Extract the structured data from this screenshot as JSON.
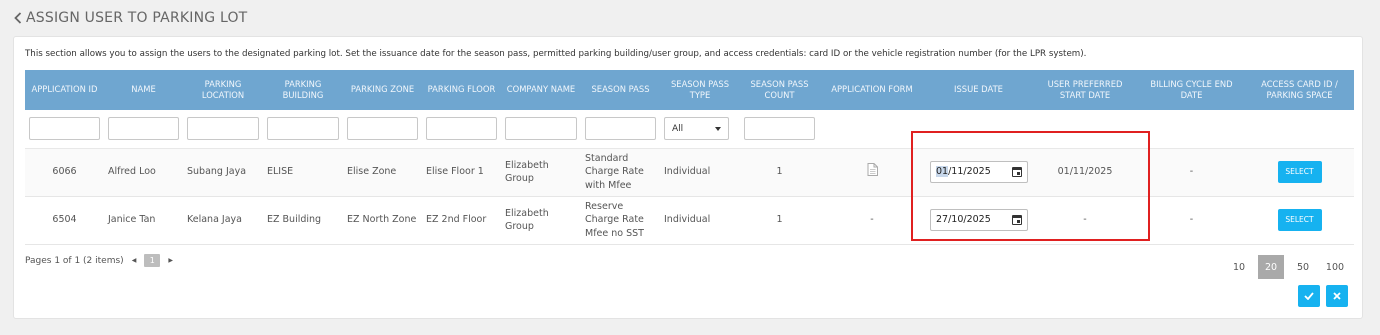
{
  "header": {
    "title": "ASSIGN USER TO PARKING LOT"
  },
  "intro_text": "This section allows you to assign the users to the designated parking lot. Set the issuance date for the season pass, permitted parking building/user group, and access credentials: card ID or the vehicle registration number (for the LPR system).",
  "columns": [
    "APPLICATION ID",
    "NAME",
    "PARKING LOCATION",
    "PARKING BUILDING",
    "PARKING ZONE",
    "PARKING FLOOR",
    "COMPANY NAME",
    "SEASON PASS",
    "SEASON PASS TYPE",
    "SEASON PASS COUNT",
    "APPLICATION FORM",
    "ISSUE DATE",
    "USER PREFERRED START DATE",
    "BILLING CYCLE END DATE",
    "ACCESS CARD ID / PARKING SPACE"
  ],
  "filter_type_value": "All",
  "rows": [
    {
      "application_id": "6066",
      "name": "Alfred Loo",
      "location": "Subang Jaya",
      "building": "ELISE",
      "zone": "Elise Zone",
      "floor": "Elise Floor 1",
      "company": "Elizabeth Group",
      "season_pass": "Standard Charge Rate with Mfee",
      "type": "Individual",
      "count": "1",
      "application_form": "document-icon",
      "issue_date_day": "01",
      "issue_date_rest": "/11/2025",
      "preferred_start": "01/11/2025",
      "billing_end": "-",
      "action_label": "SELECT"
    },
    {
      "application_id": "6504",
      "name": "Janice Tan",
      "location": "Kelana Jaya",
      "building": "EZ Building",
      "zone": "EZ North Zone",
      "floor": "EZ 2nd Floor",
      "company": "Elizabeth Group",
      "season_pass": "Reserve Charge Rate Mfee no SST",
      "type": "Individual",
      "count": "1",
      "application_form": "-",
      "issue_date": "27/10/2025",
      "preferred_start": "-",
      "billing_end": "-",
      "action_label": "SELECT"
    }
  ],
  "pager": {
    "summary": "Pages 1 of 1 (2 items)",
    "current_page": "1"
  },
  "page_sizes": [
    "10",
    "20",
    "50",
    "100"
  ],
  "active_page_size": "20",
  "colors": {
    "header_bg": "#6fa6d0",
    "accent": "#16b2f0",
    "highlight_border": "#e02020"
  }
}
